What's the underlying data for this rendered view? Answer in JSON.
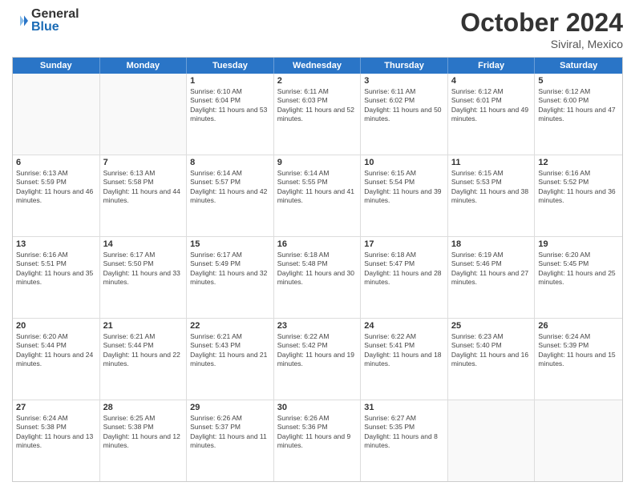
{
  "header": {
    "logo_general": "General",
    "logo_blue": "Blue",
    "month_title": "October 2024",
    "subtitle": "Siviral, Mexico"
  },
  "days_of_week": [
    "Sunday",
    "Monday",
    "Tuesday",
    "Wednesday",
    "Thursday",
    "Friday",
    "Saturday"
  ],
  "weeks": [
    [
      {
        "day": "",
        "info": ""
      },
      {
        "day": "",
        "info": ""
      },
      {
        "day": "1",
        "info": "Sunrise: 6:10 AM\nSunset: 6:04 PM\nDaylight: 11 hours and 53 minutes."
      },
      {
        "day": "2",
        "info": "Sunrise: 6:11 AM\nSunset: 6:03 PM\nDaylight: 11 hours and 52 minutes."
      },
      {
        "day": "3",
        "info": "Sunrise: 6:11 AM\nSunset: 6:02 PM\nDaylight: 11 hours and 50 minutes."
      },
      {
        "day": "4",
        "info": "Sunrise: 6:12 AM\nSunset: 6:01 PM\nDaylight: 11 hours and 49 minutes."
      },
      {
        "day": "5",
        "info": "Sunrise: 6:12 AM\nSunset: 6:00 PM\nDaylight: 11 hours and 47 minutes."
      }
    ],
    [
      {
        "day": "6",
        "info": "Sunrise: 6:13 AM\nSunset: 5:59 PM\nDaylight: 11 hours and 46 minutes."
      },
      {
        "day": "7",
        "info": "Sunrise: 6:13 AM\nSunset: 5:58 PM\nDaylight: 11 hours and 44 minutes."
      },
      {
        "day": "8",
        "info": "Sunrise: 6:14 AM\nSunset: 5:57 PM\nDaylight: 11 hours and 42 minutes."
      },
      {
        "day": "9",
        "info": "Sunrise: 6:14 AM\nSunset: 5:55 PM\nDaylight: 11 hours and 41 minutes."
      },
      {
        "day": "10",
        "info": "Sunrise: 6:15 AM\nSunset: 5:54 PM\nDaylight: 11 hours and 39 minutes."
      },
      {
        "day": "11",
        "info": "Sunrise: 6:15 AM\nSunset: 5:53 PM\nDaylight: 11 hours and 38 minutes."
      },
      {
        "day": "12",
        "info": "Sunrise: 6:16 AM\nSunset: 5:52 PM\nDaylight: 11 hours and 36 minutes."
      }
    ],
    [
      {
        "day": "13",
        "info": "Sunrise: 6:16 AM\nSunset: 5:51 PM\nDaylight: 11 hours and 35 minutes."
      },
      {
        "day": "14",
        "info": "Sunrise: 6:17 AM\nSunset: 5:50 PM\nDaylight: 11 hours and 33 minutes."
      },
      {
        "day": "15",
        "info": "Sunrise: 6:17 AM\nSunset: 5:49 PM\nDaylight: 11 hours and 32 minutes."
      },
      {
        "day": "16",
        "info": "Sunrise: 6:18 AM\nSunset: 5:48 PM\nDaylight: 11 hours and 30 minutes."
      },
      {
        "day": "17",
        "info": "Sunrise: 6:18 AM\nSunset: 5:47 PM\nDaylight: 11 hours and 28 minutes."
      },
      {
        "day": "18",
        "info": "Sunrise: 6:19 AM\nSunset: 5:46 PM\nDaylight: 11 hours and 27 minutes."
      },
      {
        "day": "19",
        "info": "Sunrise: 6:20 AM\nSunset: 5:45 PM\nDaylight: 11 hours and 25 minutes."
      }
    ],
    [
      {
        "day": "20",
        "info": "Sunrise: 6:20 AM\nSunset: 5:44 PM\nDaylight: 11 hours and 24 minutes."
      },
      {
        "day": "21",
        "info": "Sunrise: 6:21 AM\nSunset: 5:44 PM\nDaylight: 11 hours and 22 minutes."
      },
      {
        "day": "22",
        "info": "Sunrise: 6:21 AM\nSunset: 5:43 PM\nDaylight: 11 hours and 21 minutes."
      },
      {
        "day": "23",
        "info": "Sunrise: 6:22 AM\nSunset: 5:42 PM\nDaylight: 11 hours and 19 minutes."
      },
      {
        "day": "24",
        "info": "Sunrise: 6:22 AM\nSunset: 5:41 PM\nDaylight: 11 hours and 18 minutes."
      },
      {
        "day": "25",
        "info": "Sunrise: 6:23 AM\nSunset: 5:40 PM\nDaylight: 11 hours and 16 minutes."
      },
      {
        "day": "26",
        "info": "Sunrise: 6:24 AM\nSunset: 5:39 PM\nDaylight: 11 hours and 15 minutes."
      }
    ],
    [
      {
        "day": "27",
        "info": "Sunrise: 6:24 AM\nSunset: 5:38 PM\nDaylight: 11 hours and 13 minutes."
      },
      {
        "day": "28",
        "info": "Sunrise: 6:25 AM\nSunset: 5:38 PM\nDaylight: 11 hours and 12 minutes."
      },
      {
        "day": "29",
        "info": "Sunrise: 6:26 AM\nSunset: 5:37 PM\nDaylight: 11 hours and 11 minutes."
      },
      {
        "day": "30",
        "info": "Sunrise: 6:26 AM\nSunset: 5:36 PM\nDaylight: 11 hours and 9 minutes."
      },
      {
        "day": "31",
        "info": "Sunrise: 6:27 AM\nSunset: 5:35 PM\nDaylight: 11 hours and 8 minutes."
      },
      {
        "day": "",
        "info": ""
      },
      {
        "day": "",
        "info": ""
      }
    ]
  ]
}
